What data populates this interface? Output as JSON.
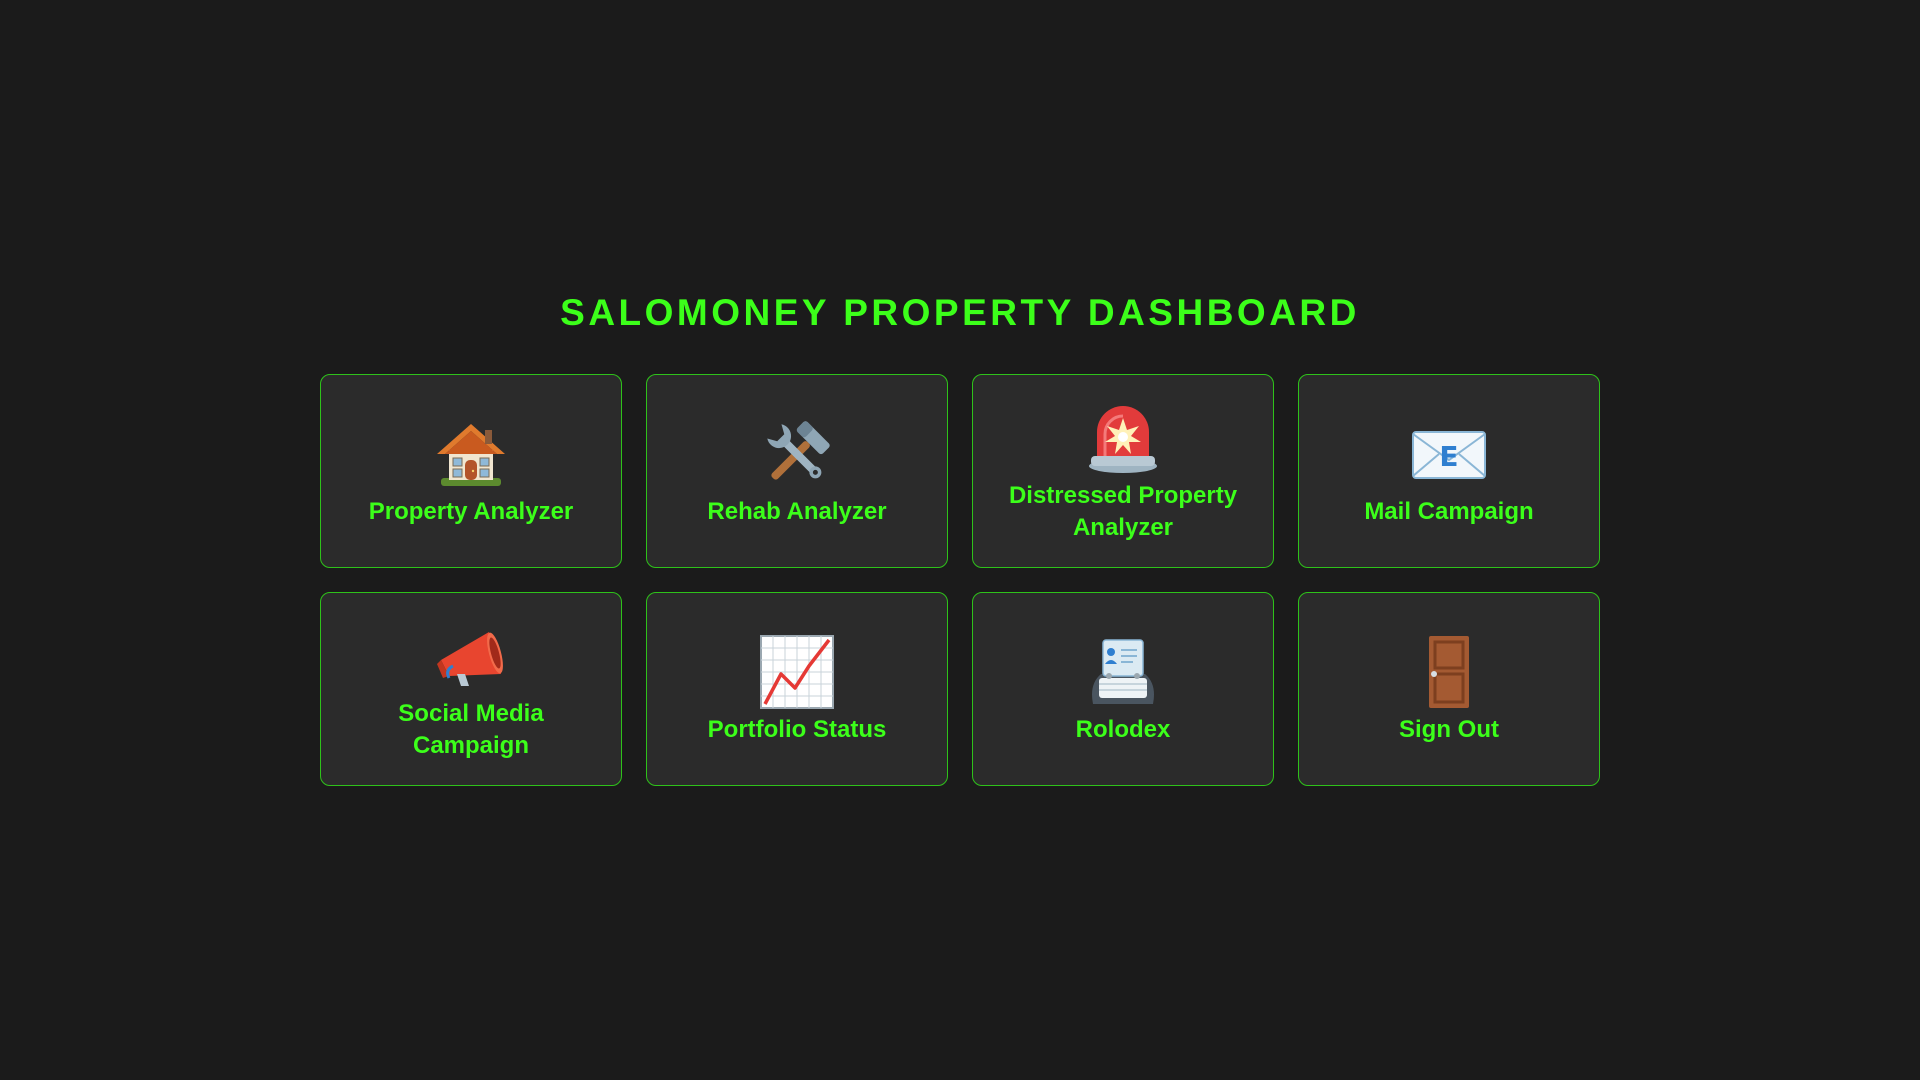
{
  "dashboard": {
    "title": "SALOMONEY PROPERTY DASHBOARD",
    "accent_color": "#3cff1a",
    "cards": [
      {
        "label": "Property Analyzer",
        "icon": "house-icon"
      },
      {
        "label": "Rehab Analyzer",
        "icon": "hammer-wrench-icon"
      },
      {
        "label": "Distressed Property Analyzer",
        "icon": "siren-icon"
      },
      {
        "label": "Mail Campaign",
        "icon": "email-envelope-icon"
      },
      {
        "label": "Social Media Campaign",
        "icon": "megaphone-icon"
      },
      {
        "label": "Portfolio Status",
        "icon": "chart-increasing-icon"
      },
      {
        "label": "Rolodex",
        "icon": "rolodex-icon"
      },
      {
        "label": "Sign Out",
        "icon": "door-icon"
      }
    ]
  }
}
